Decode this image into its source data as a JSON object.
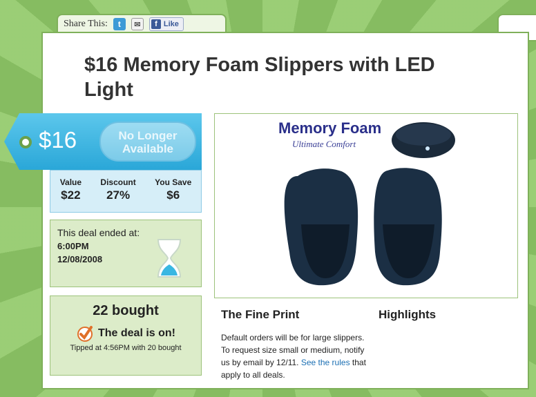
{
  "share": {
    "label": "Share This:",
    "twitter_glyph": "t",
    "email_glyph": "✉",
    "like_label": "Like"
  },
  "deal": {
    "title": "$16 Memory Foam Slippers with LED Light",
    "price": "$16",
    "status_button": "No Longer Available",
    "value_label": "Value",
    "value": "$22",
    "discount_label": "Discount",
    "discount": "27%",
    "save_label": "You Save",
    "save": "$6"
  },
  "ended": {
    "label": "This deal ended at:",
    "time": "6:00PM",
    "date": "12/08/2008"
  },
  "bought": {
    "count_text": "22  bought",
    "deal_on": "The deal is on!",
    "tipped": "Tipped at 4:56PM with 20 bought"
  },
  "image": {
    "title": "Memory Foam",
    "subtitle": "Ultimate Comfort"
  },
  "fine_print": {
    "heading": "The Fine Print",
    "body": "Default orders will be for large slippers. To request size small or medium, notify us by email by 12/11.",
    "link": "See the rules",
    "tail": " that apply to all deals."
  },
  "highlights": {
    "heading": "Highlights"
  },
  "colors": {
    "tag_blue": "#2aa7d8",
    "green_border": "#7fb05a",
    "panel_green": "#dcecc9",
    "link_blue": "#1b6fb3"
  }
}
